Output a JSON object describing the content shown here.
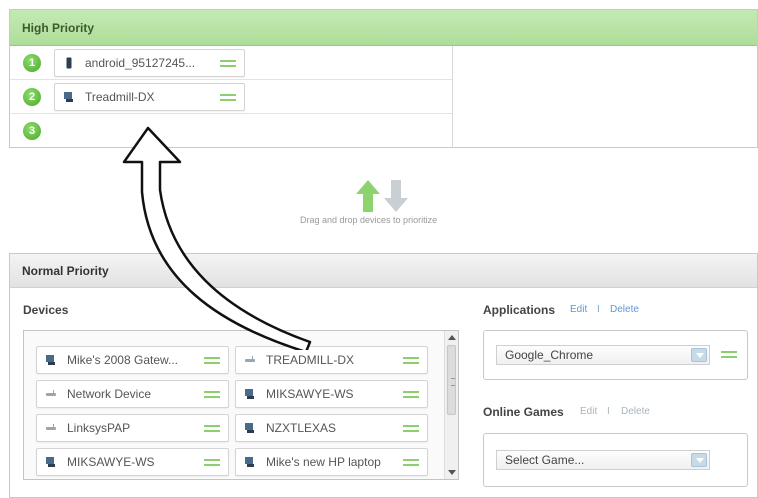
{
  "high_priority": {
    "title": "High Priority",
    "slots": [
      {
        "number": "1",
        "device": "android_95127245...",
        "icon": "phone-icon"
      },
      {
        "number": "2",
        "device": "Treadmill-DX",
        "icon": "computer-icon"
      },
      {
        "number": "3",
        "device": ""
      }
    ]
  },
  "drag_hint": "Drag and drop devices to prioritize",
  "normal_priority": {
    "title": "Normal Priority",
    "devices_title": "Devices",
    "devices": [
      {
        "label": "Mike's 2008 Gatew...",
        "icon": "computer-icon"
      },
      {
        "label": "TREADMILL-DX",
        "icon": "router-icon"
      },
      {
        "label": "Network Device",
        "icon": "router-icon"
      },
      {
        "label": "MIKSAWYE-WS",
        "icon": "computer-icon"
      },
      {
        "label": "LinksysPAP",
        "icon": "router-icon"
      },
      {
        "label": "NZXTLEXAS",
        "icon": "computer-icon"
      },
      {
        "label": "MIKSAWYE-WS",
        "icon": "computer-icon"
      },
      {
        "label": "Mike's new HP laptop",
        "icon": "computer-icon"
      }
    ],
    "applications": {
      "title": "Applications",
      "edit": "Edit",
      "separator": "I",
      "delete": "Delete",
      "selected": "Google_Chrome"
    },
    "online_games": {
      "title": "Online Games",
      "edit": "Edit",
      "separator": "I",
      "delete": "Delete",
      "placeholder": "Select Game..."
    }
  },
  "colors": {
    "accent_green": "#8dcf6c",
    "header_green": "#aedd99",
    "link_blue": "#5a9ad4"
  }
}
